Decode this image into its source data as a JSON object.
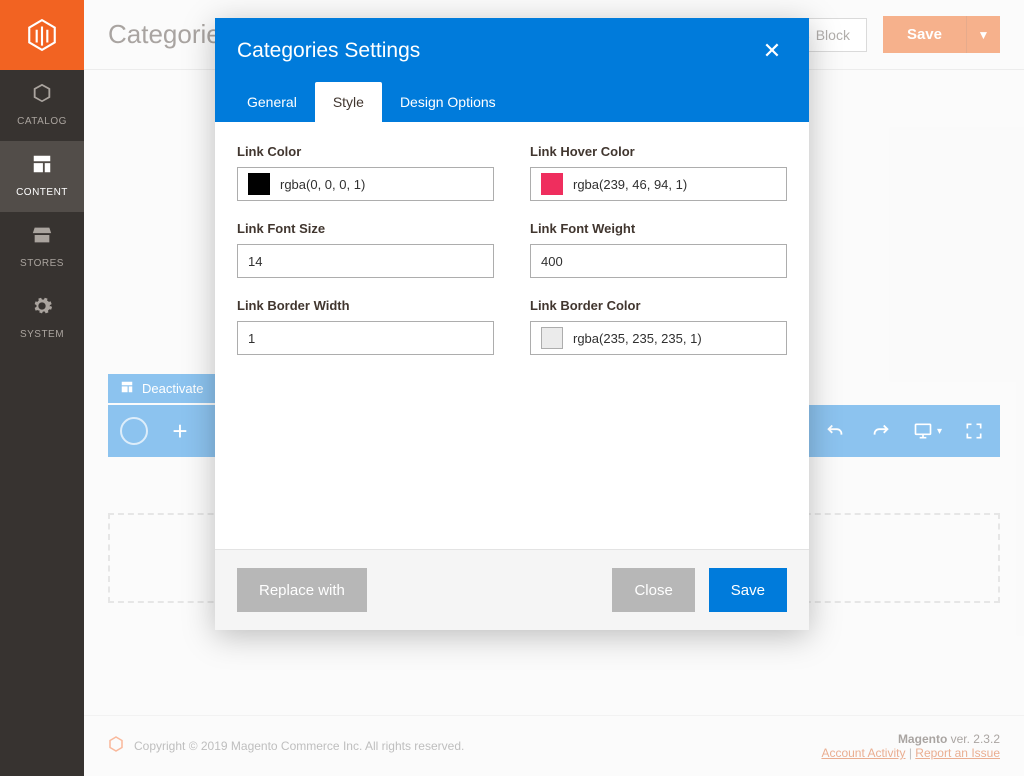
{
  "sidebar": {
    "items": [
      {
        "icon": "cube",
        "label": "CATALOG"
      },
      {
        "icon": "layout",
        "label": "CONTENT"
      },
      {
        "icon": "store",
        "label": "STORES"
      },
      {
        "icon": "gear",
        "label": "SYSTEM"
      }
    ],
    "active_index": 1
  },
  "header": {
    "page_title": "Categories",
    "back_label": "Block",
    "save_label": "Save",
    "caret": "▼"
  },
  "editor": {
    "deactivate_label": "Deactivate",
    "loading_icon": "◯",
    "plus_icon": "+",
    "undo_icon": "↶",
    "redo_icon": "↻",
    "device_icon": "desktop",
    "device_caret": "▾",
    "fullscreen_icon": "⛶",
    "dropzone_plus": "+"
  },
  "footer": {
    "copyright": "Copyright © 2019 Magento Commerce Inc. All rights reserved.",
    "brand": "Magento",
    "version_prefix": " ver. ",
    "version": "2.3.2",
    "link_activity": "Account Activity",
    "link_issue": "Report an Issue",
    "sep": " | "
  },
  "modal": {
    "title": "Categories Settings",
    "close_glyph": "✕",
    "tabs": [
      {
        "label": "General"
      },
      {
        "label": "Style"
      },
      {
        "label": "Design Options"
      }
    ],
    "active_tab_index": 1,
    "fields": {
      "link_color": {
        "label": "Link Color",
        "value": "rgba(0, 0, 0, 1)",
        "swatch": "#010101"
      },
      "link_hover_color": {
        "label": "Link Hover Color",
        "value": "rgba(239, 46, 94, 1)",
        "swatch": "#ef2e5e"
      },
      "link_font_size": {
        "label": "Link Font Size",
        "value": "14"
      },
      "link_font_weight": {
        "label": "Link Font Weight",
        "value": "400"
      },
      "link_border_width": {
        "label": "Link Border Width",
        "value": "1"
      },
      "link_border_color": {
        "label": "Link Border Color",
        "value": "rgba(235, 235, 235, 1)",
        "swatch": "#ebebeb"
      }
    },
    "buttons": {
      "replace": "Replace with",
      "close": "Close",
      "save": "Save"
    }
  }
}
